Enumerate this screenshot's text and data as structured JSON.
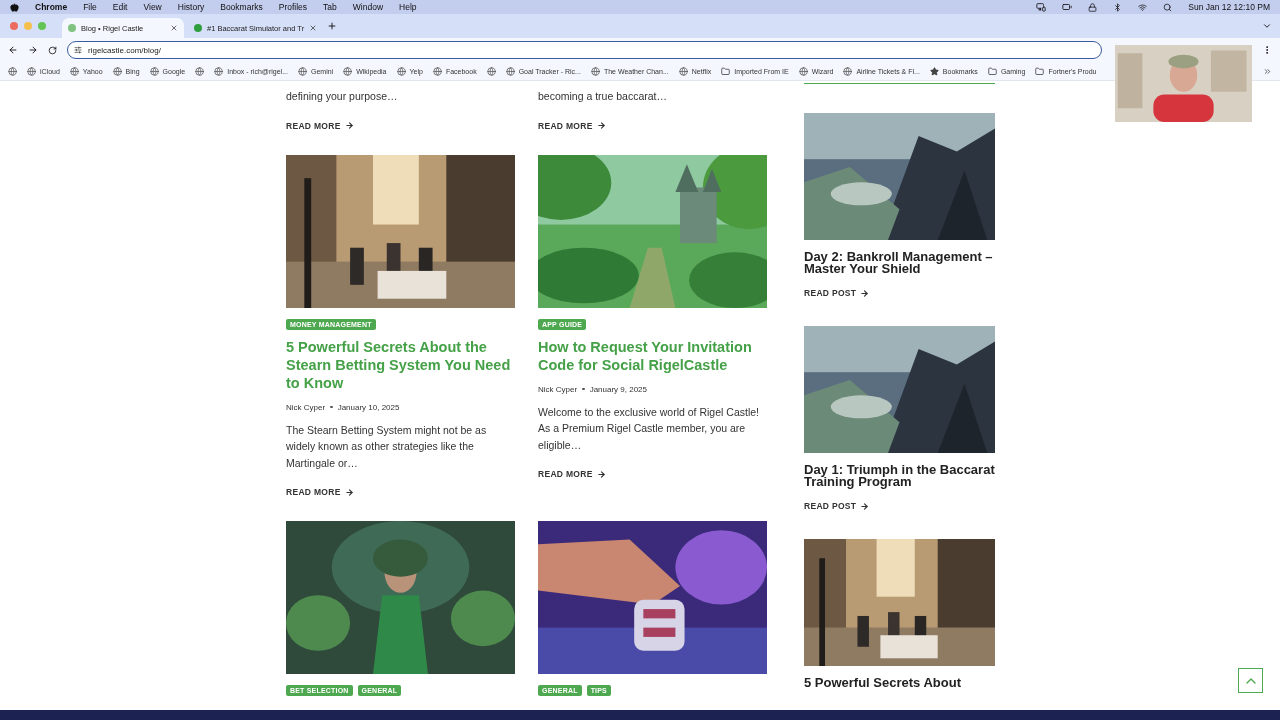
{
  "menubar": {
    "app": "Chrome",
    "menus": [
      "File",
      "Edit",
      "View",
      "History",
      "Bookmarks",
      "Profiles",
      "Tab",
      "Window",
      "Help"
    ],
    "clock": "Sun Jan 12  12:10 PM"
  },
  "tabs": [
    {
      "title": "Blog • Rigel Castle",
      "selected": true
    },
    {
      "title": "#1 Baccarat Simulator and Tr",
      "selected": false
    }
  ],
  "address": {
    "url": "rigelcastle.com/blog/"
  },
  "bookmarks": [
    {
      "kind": "site"
    },
    {
      "kind": "site",
      "label": "iCloud"
    },
    {
      "kind": "site",
      "label": "Yahoo"
    },
    {
      "kind": "site",
      "label": "Bing"
    },
    {
      "kind": "site",
      "label": "Google"
    },
    {
      "kind": "site"
    },
    {
      "kind": "site",
      "label": "Inbox - rich@rigel..."
    },
    {
      "kind": "site",
      "label": "Gemini"
    },
    {
      "kind": "site",
      "label": "Wikipedia"
    },
    {
      "kind": "site",
      "label": "Yelp"
    },
    {
      "kind": "site",
      "label": "Facebook"
    },
    {
      "kind": "site"
    },
    {
      "kind": "site",
      "label": "Goal Tracker - Ric..."
    },
    {
      "kind": "site",
      "label": "The Weather Chan..."
    },
    {
      "kind": "site",
      "label": "Netflix"
    },
    {
      "kind": "folder",
      "label": "Imported From IE"
    },
    {
      "kind": "site",
      "label": "Wizard"
    },
    {
      "kind": "site",
      "label": "Airline Tickets & Fl..."
    },
    {
      "kind": "star",
      "label": "Bookmarks"
    },
    {
      "kind": "folder",
      "label": "Gaming"
    },
    {
      "kind": "folder",
      "label": "Fortner's Produ"
    }
  ],
  "posts": [
    {
      "excerpt": "defining your purpose…",
      "link": "READ MORE"
    },
    {
      "excerpt": "becoming a true baccarat…",
      "link": "READ MORE"
    },
    {
      "picture": {
        "kind": "city"
      },
      "tags": [
        "MONEY MANAGEMENT"
      ],
      "title": "5 Powerful Secrets About the Stearn Betting System You Need to Know",
      "author": "Nick Cyper",
      "date": "January 10, 2025",
      "excerpt": "The Stearn Betting System might not be as widely known as other strategies like the Martingale or…",
      "link": "READ MORE"
    },
    {
      "picture": {
        "kind": "forest"
      },
      "tags": [
        "APP GUIDE"
      ],
      "title": "How to Request Your Invitation Code for Social RigelCastle",
      "author": "Nick Cyper",
      "date": "January 9, 2025",
      "excerpt": "Welcome to the exclusive world of Rigel Castle! As a Premium Rigel Castle member, you are eligible…",
      "link": "READ MORE"
    },
    {
      "picture": {
        "kind": "fantasy"
      },
      "tags": [
        "BET SELECTION",
        "GENERAL"
      ]
    },
    {
      "picture": {
        "kind": "chips"
      },
      "tags": [
        "GENERAL",
        "TIPS"
      ]
    }
  ],
  "sidebar": [
    {
      "picture": {
        "kind": "mountain"
      },
      "title": "Day 2: Bankroll Management – Master Your Shield",
      "link": "READ POST"
    },
    {
      "picture": {
        "kind": "mountain"
      },
      "title": "Day 1: Triumph in the Baccarat Training Program",
      "link": "READ POST"
    },
    {
      "picture": {
        "kind": "city"
      },
      "title": "5 Powerful Secrets About"
    }
  ]
}
